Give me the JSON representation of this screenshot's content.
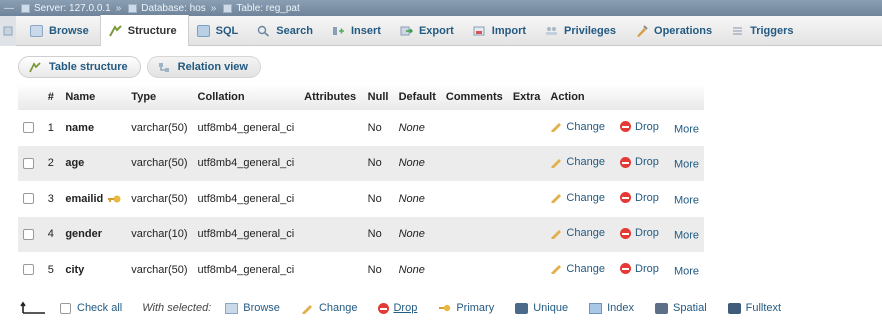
{
  "breadcrumb": {
    "server": "Server: 127.0.0.1",
    "database": "Database: hos",
    "table": "Table: reg_pat"
  },
  "tabs": [
    {
      "label": "Browse",
      "icon": "browse-icon",
      "active": false
    },
    {
      "label": "Structure",
      "icon": "structure-icon",
      "active": true
    },
    {
      "label": "SQL",
      "icon": "sql-icon",
      "active": false
    },
    {
      "label": "Search",
      "icon": "search-icon",
      "active": false
    },
    {
      "label": "Insert",
      "icon": "insert-icon",
      "active": false
    },
    {
      "label": "Export",
      "icon": "export-icon",
      "active": false
    },
    {
      "label": "Import",
      "icon": "import-icon",
      "active": false
    },
    {
      "label": "Privileges",
      "icon": "privileges-icon",
      "active": false
    },
    {
      "label": "Operations",
      "icon": "operations-icon",
      "active": false
    },
    {
      "label": "Triggers",
      "icon": "triggers-icon",
      "active": false
    }
  ],
  "subtabs": {
    "table_structure": "Table structure",
    "relation_view": "Relation view"
  },
  "table": {
    "headers": {
      "num": "#",
      "name": "Name",
      "type": "Type",
      "collation": "Collation",
      "attributes": "Attributes",
      "null": "Null",
      "default": "Default",
      "comments": "Comments",
      "extra": "Extra",
      "action": "Action"
    },
    "rows": [
      {
        "num": "1",
        "name": "name",
        "type": "varchar(50)",
        "collation": "utf8mb4_general_ci",
        "null": "No",
        "default": "None",
        "key": false
      },
      {
        "num": "2",
        "name": "age",
        "type": "varchar(50)",
        "collation": "utf8mb4_general_ci",
        "null": "No",
        "default": "None",
        "key": false
      },
      {
        "num": "3",
        "name": "emailid",
        "type": "varchar(50)",
        "collation": "utf8mb4_general_ci",
        "null": "No",
        "default": "None",
        "key": true
      },
      {
        "num": "4",
        "name": "gender",
        "type": "varchar(10)",
        "collation": "utf8mb4_general_ci",
        "null": "No",
        "default": "None",
        "key": false
      },
      {
        "num": "5",
        "name": "city",
        "type": "varchar(50)",
        "collation": "utf8mb4_general_ci",
        "null": "No",
        "default": "None",
        "key": false
      }
    ],
    "actions": {
      "change": "Change",
      "drop": "Drop",
      "more": "More"
    }
  },
  "footer": {
    "check_all": "Check all",
    "with_selected": "With selected:",
    "buttons": {
      "browse": "Browse",
      "change": "Change",
      "drop": "Drop",
      "primary": "Primary",
      "unique": "Unique",
      "index": "Index",
      "spatial": "Spatial",
      "fulltext": "Fulltext"
    }
  },
  "colors": {
    "link": "#235a81",
    "drop_red": "#e53935",
    "topbar": "#7b90a5",
    "row_alt": "#ececec"
  }
}
